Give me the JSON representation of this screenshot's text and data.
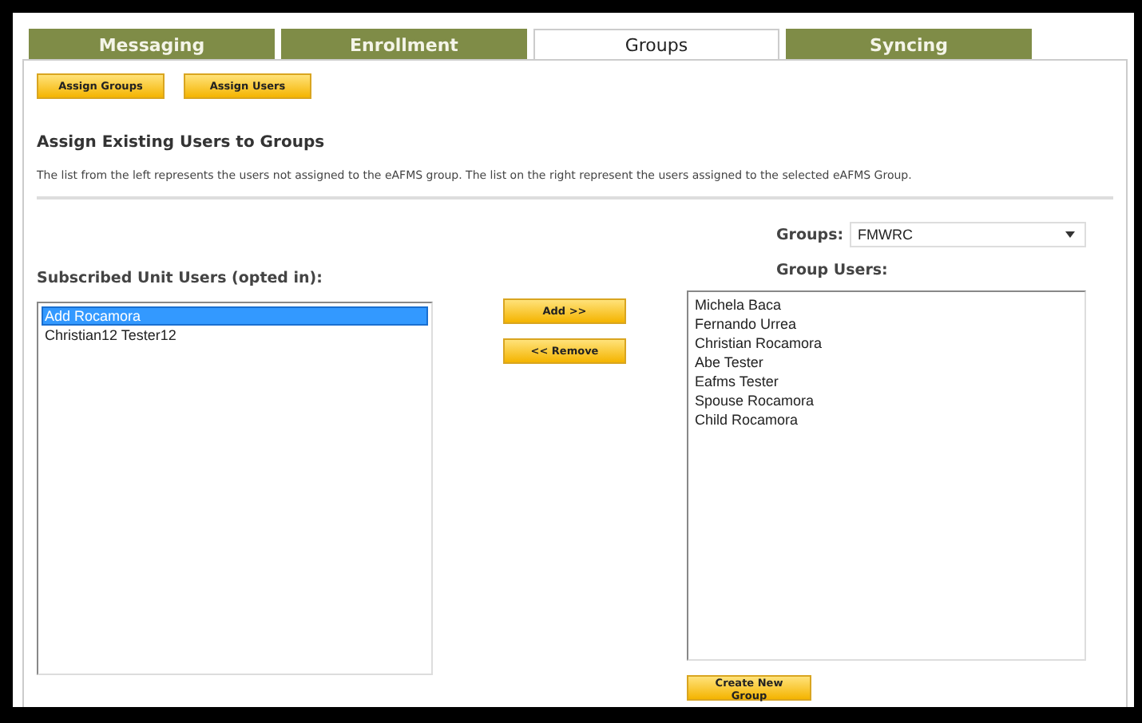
{
  "tabs": [
    {
      "label": "Messaging",
      "selected": false
    },
    {
      "label": "Enrollment",
      "selected": false
    },
    {
      "label": "Groups",
      "selected": true
    },
    {
      "label": "Syncing",
      "selected": false
    }
  ],
  "toolbar_buttons": [
    "Assign Groups",
    "Assign Users"
  ],
  "heading": "Assign Existing Users to Groups",
  "description": "The list from the left represents the users not assigned to the eAFMS group. The list on the right represent the users assigned to the selected eAFMS Group.",
  "left_list": {
    "label": "Subscribed Unit Users (opted in):",
    "items": [
      {
        "text": "Add Rocamora",
        "selected": true
      },
      {
        "text": "Christian12 Tester12",
        "selected": false
      }
    ]
  },
  "move_buttons": [
    "Add >>",
    "<< Remove"
  ],
  "groups_select": {
    "label": "Groups:",
    "value": "FMWRC"
  },
  "right_list": {
    "label": "Group Users:",
    "items": [
      {
        "text": "Michela Baca",
        "selected": false
      },
      {
        "text": "Fernando Urrea",
        "selected": false
      },
      {
        "text": "Christian Rocamora",
        "selected": false
      },
      {
        "text": "Abe Tester",
        "selected": false
      },
      {
        "text": "Eafms Tester",
        "selected": false
      },
      {
        "text": "Spouse Rocamora",
        "selected": false
      },
      {
        "text": "Child Rocamora",
        "selected": false
      }
    ]
  },
  "create_button": "Create New Group"
}
